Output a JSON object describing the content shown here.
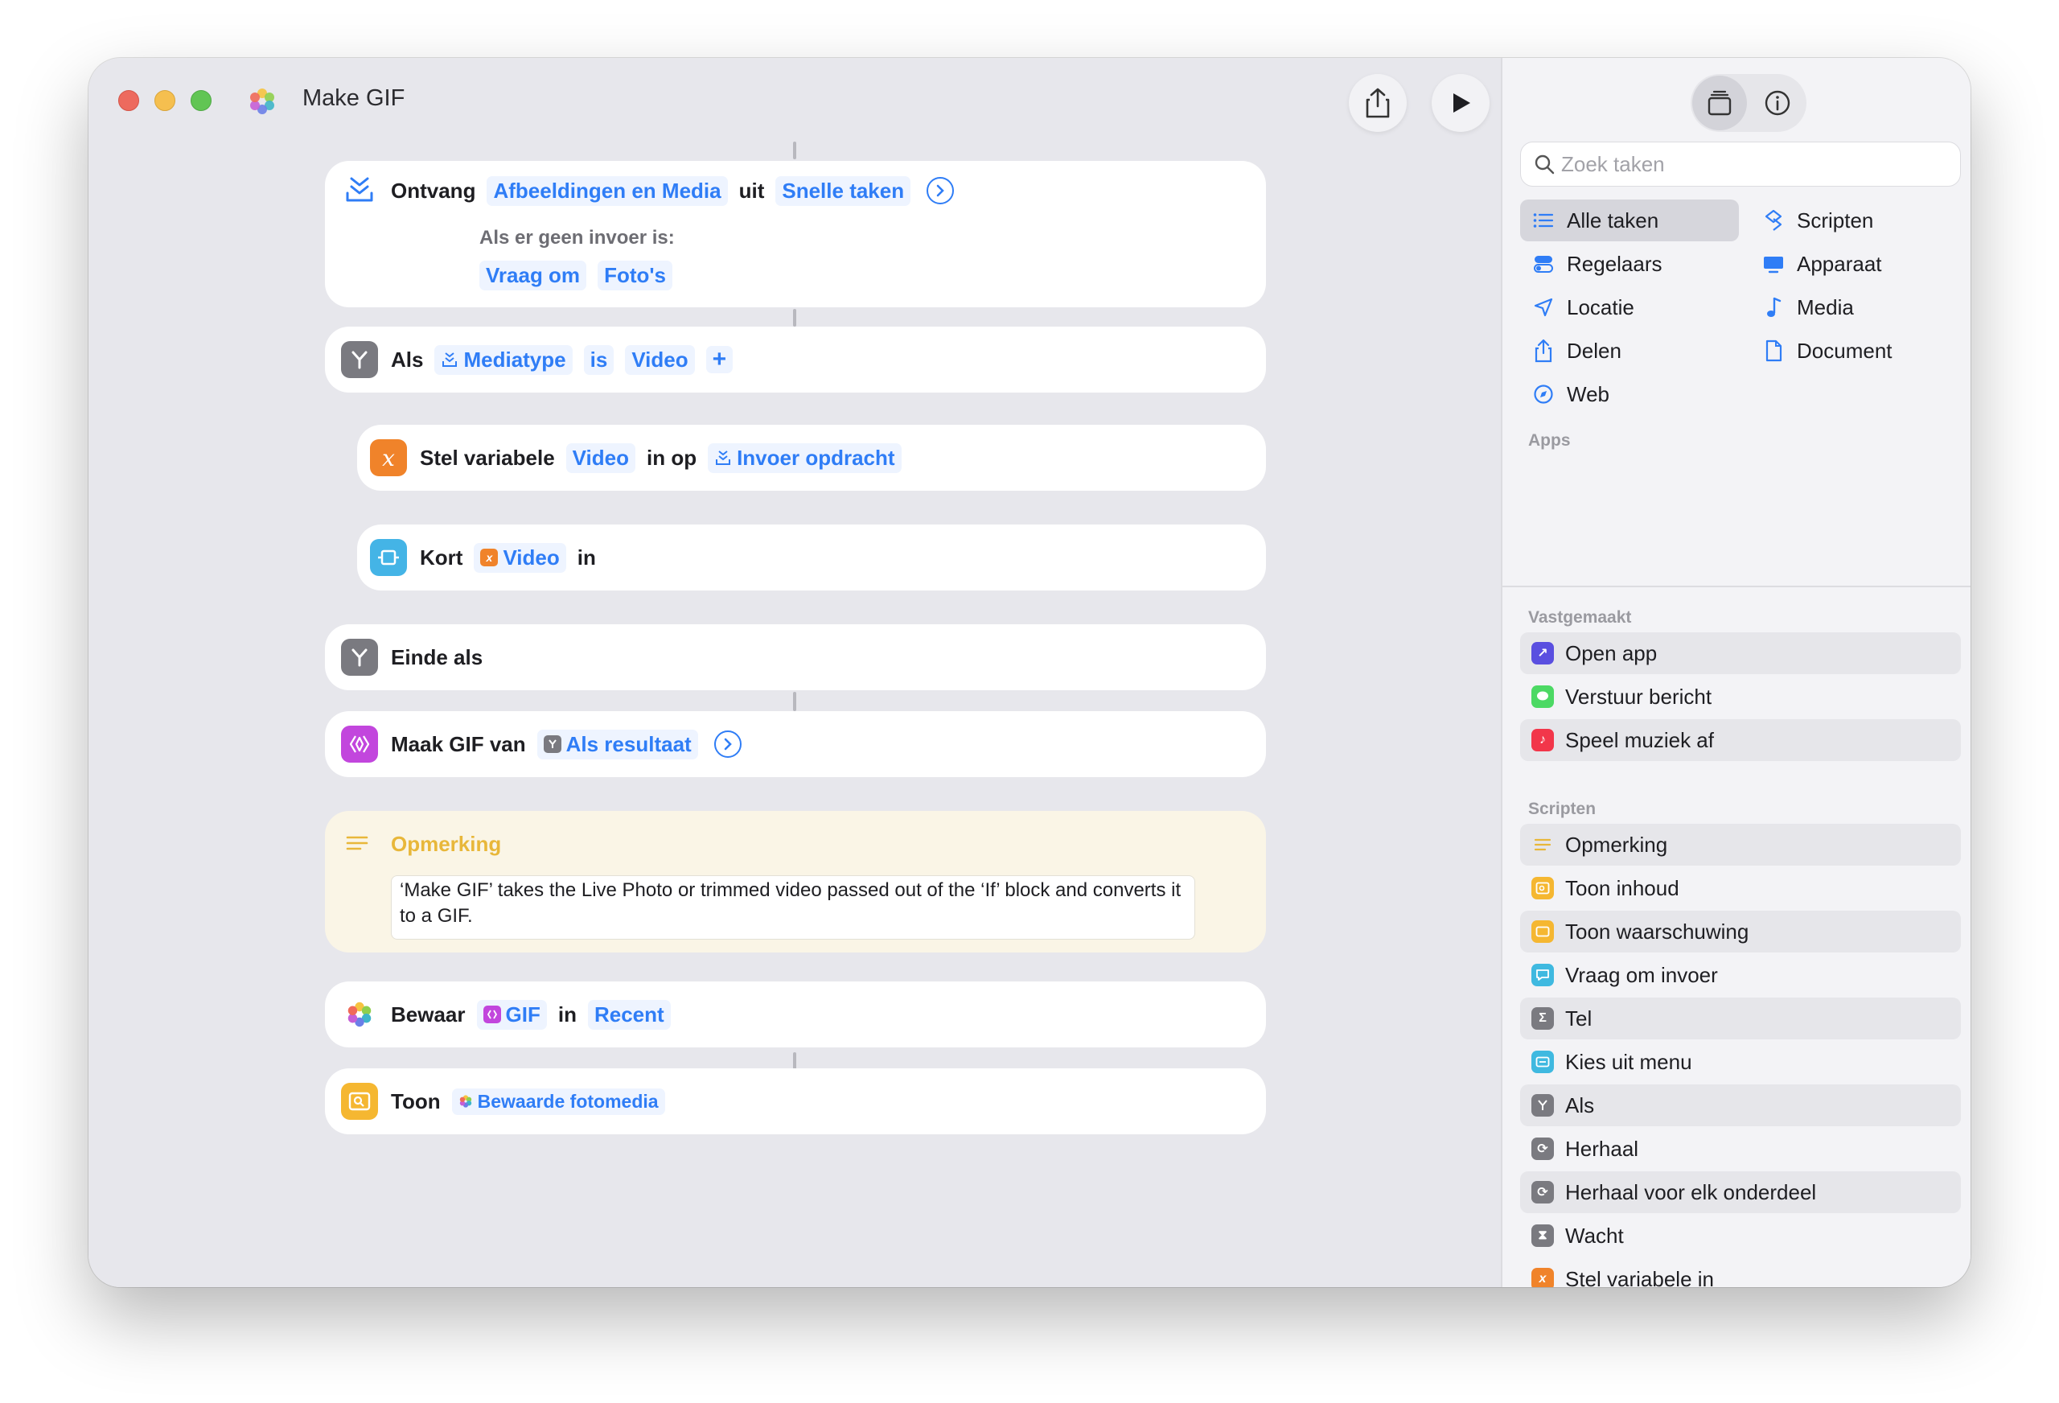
{
  "window": {
    "title": "Make GIF"
  },
  "toolbar": {
    "share": "share",
    "run": "run"
  },
  "workflow": {
    "receive": {
      "kw1": "Ontvang",
      "tok1": "Afbeeldingen en Media",
      "kw2": "uit",
      "tok2": "Snelle taken",
      "sub": "Als er geen invoer is:",
      "tok3": "Vraag om",
      "tok4": "Foto's"
    },
    "if": {
      "kw1": "Als",
      "tok1": "Mediatype",
      "tok2": "is",
      "tok3": "Video",
      "plus": "+"
    },
    "setvar": {
      "kw1": "Stel variabele",
      "tok1": "Video",
      "kw2": "in op",
      "tok2": "Invoer opdracht"
    },
    "trim": {
      "kw1": "Kort",
      "tok1": "Video",
      "kw2": "in"
    },
    "endif": {
      "kw1": "Einde als"
    },
    "makegif": {
      "kw1": "Maak GIF van",
      "tok1": "Als resultaat"
    },
    "comment": {
      "title": "Opmerking",
      "text": "‘Make GIF’ takes the Live Photo or trimmed video passed out of the ‘If’ block and converts it to a GIF."
    },
    "save": {
      "kw1": "Bewaar",
      "tok1": "GIF",
      "kw2": "in",
      "tok2": "Recent"
    },
    "show": {
      "kw1": "Toon",
      "tok1": "Bewaarde fotomedia"
    }
  },
  "sidebar": {
    "search_placeholder": "Zoek taken",
    "categories": [
      "Alle taken",
      "Scripten",
      "Regelaars",
      "Apparaat",
      "Locatie",
      "Media",
      "Delen",
      "Document",
      "Web"
    ],
    "apps_label": "Apps",
    "pinned_label": "Vastgemaakt",
    "pinned": [
      "Open app",
      "Verstuur bericht",
      "Speel muziek af"
    ],
    "scripts_label": "Scripten",
    "scripts": [
      "Opmerking",
      "Toon inhoud",
      "Toon waarschuwing",
      "Vraag om invoer",
      "Tel",
      "Kies uit menu",
      "Als",
      "Herhaal",
      "Herhaal voor elk onderdeel",
      "Wacht",
      "Stel variabele in"
    ]
  },
  "colors": {
    "accent": "#2f7df6",
    "variable": "#f0832a",
    "gif": "#c246dd",
    "note": "#e8b73a"
  }
}
